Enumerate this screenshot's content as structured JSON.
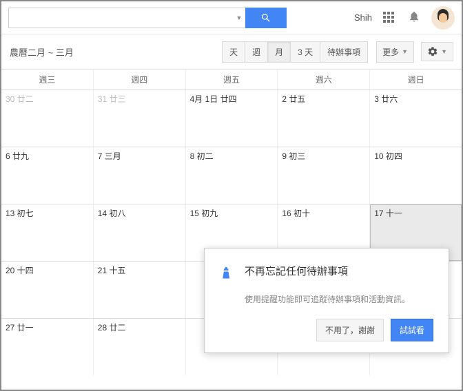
{
  "header": {
    "search_placeholder": "",
    "username": "Shih"
  },
  "toolbar": {
    "lunar": "農曆二月 ~ 三月",
    "views": {
      "day": "天",
      "week": "週",
      "month": "月",
      "three_day": "3 天",
      "tasks": "待辦事項"
    },
    "more": "更多"
  },
  "calendar": {
    "headers": [
      "週三",
      "週四",
      "週五",
      "週六",
      "週日"
    ],
    "rows": [
      [
        {
          "text": "30 廿二",
          "prev": true
        },
        {
          "text": "31 廿三",
          "prev": true
        },
        {
          "text": "4月 1日 廿四"
        },
        {
          "text": "2 廿五"
        },
        {
          "text": "3 廿六"
        }
      ],
      [
        {
          "text": "6 廿九"
        },
        {
          "text": "7 三月"
        },
        {
          "text": "8 初二"
        },
        {
          "text": "9 初三"
        },
        {
          "text": "10 初四"
        }
      ],
      [
        {
          "text": "13 初七"
        },
        {
          "text": "14 初八"
        },
        {
          "text": "15 初九"
        },
        {
          "text": "16 初十"
        },
        {
          "text": "17 十一",
          "today": true
        }
      ],
      [
        {
          "text": "20 十四"
        },
        {
          "text": "21 十五"
        },
        {
          "text": ""
        },
        {
          "text": ""
        },
        {
          "text": ""
        }
      ],
      [
        {
          "text": "27 廿一"
        },
        {
          "text": "28 廿二"
        },
        {
          "text": ""
        },
        {
          "text": ""
        },
        {
          "text": ""
        }
      ]
    ]
  },
  "popup": {
    "title": "不再忘記任何待辦事項",
    "subtitle": "使用提醒功能即可追蹤待辦事項和活動資訊。",
    "dismiss": "不用了，謝謝",
    "try": "試試看"
  }
}
